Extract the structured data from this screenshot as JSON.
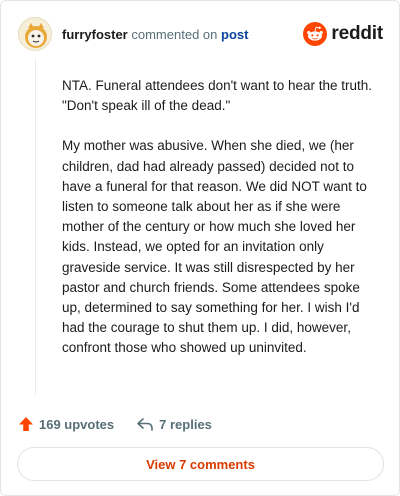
{
  "comment": {
    "username": "furryfoster",
    "commented_on": "commented on",
    "post_link": "post",
    "paragraphs": [
      "NTA. Funeral attendees don't want to hear the truth. \"Don't speak ill of the dead.\"",
      "My mother was abusive. When she died, we (her children, dad had already passed) decided not to have a funeral for that reason. We did NOT want to listen to someone talk about her as if she were mother of the century or how much she loved her kids. Instead, we opted for an invitation only graveside service. It was still disrespected by her pastor and church friends. Some attendees spoke up, determined to say something for her. I wish I'd had the courage to shut them up. I did, however, confront those who showed up uninvited."
    ]
  },
  "brand": {
    "wordmark": "reddit",
    "color": "#ff4500"
  },
  "actions": {
    "upvotes": "169 upvotes",
    "replies": "7 replies"
  },
  "footer": {
    "view_comments": "View 7 comments",
    "accent": "#d93a00"
  },
  "icons": {
    "avatar": "snoo-avatar-icon",
    "logo": "reddit-logo-icon",
    "upvote": "upvote-arrow-icon",
    "reply": "reply-arrow-icon"
  }
}
